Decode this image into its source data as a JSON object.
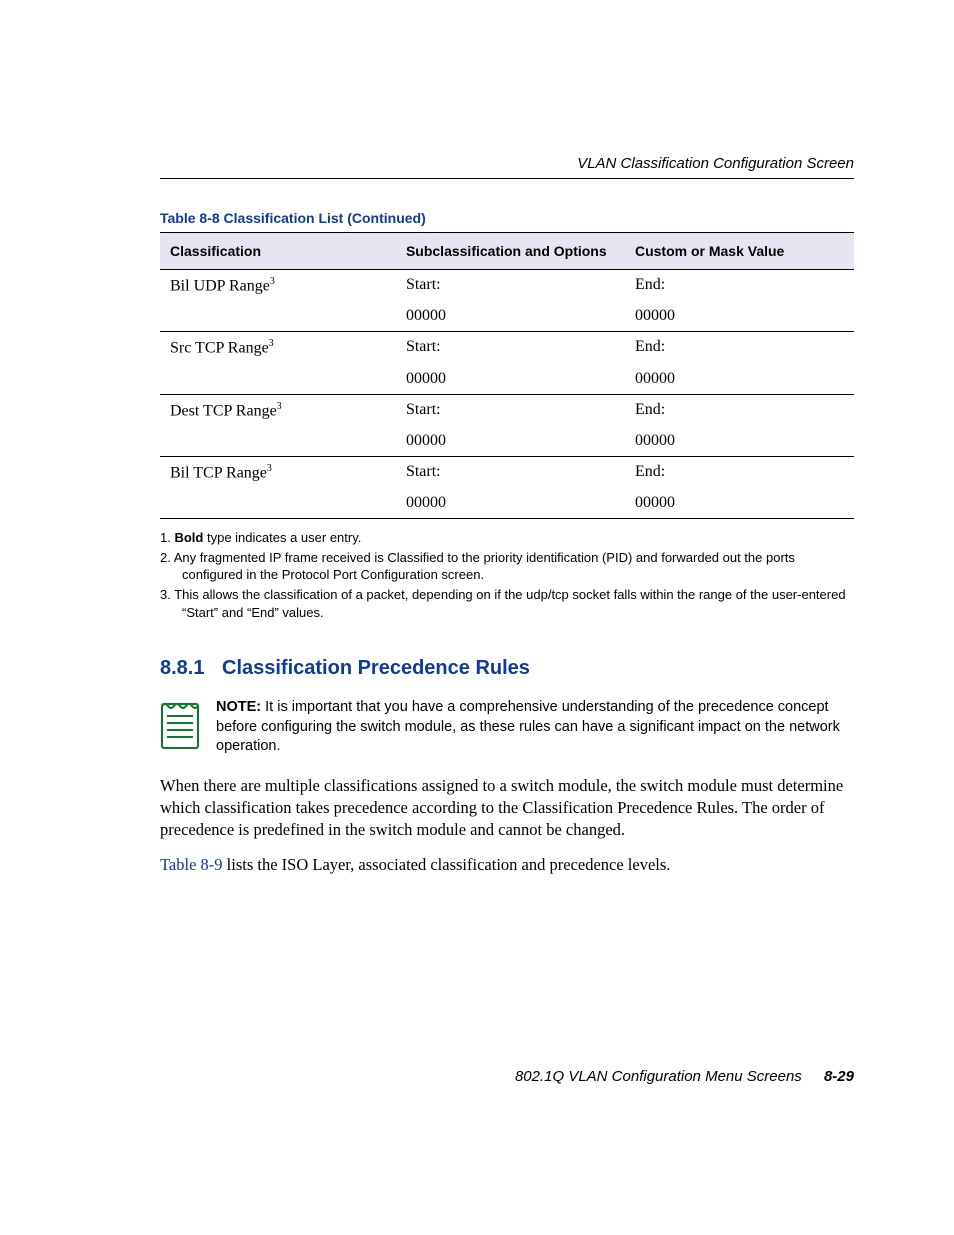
{
  "header": {
    "running_head": "VLAN Classification Configuration Screen"
  },
  "table": {
    "caption": "Table 8-8   Classification List (Continued)",
    "columns": {
      "c1": "Classification",
      "c2": "Subclassification and Options",
      "c3": "Custom or Mask Value"
    },
    "rows": [
      {
        "name": "Bil UDP Range",
        "sup": "3",
        "start_label": "Start:",
        "end_label": "End:",
        "start_val": "00000",
        "end_val": "00000"
      },
      {
        "name": "Src TCP Range",
        "sup": "3",
        "start_label": "Start:",
        "end_label": "End:",
        "start_val": "00000",
        "end_val": "00000"
      },
      {
        "name": "Dest TCP Range",
        "sup": "3",
        "start_label": "Start:",
        "end_label": "End:",
        "start_val": "00000",
        "end_val": "00000"
      },
      {
        "name": "Bil TCP Range",
        "sup": "3",
        "start_label": "Start:",
        "end_label": "End:",
        "start_val": "00000",
        "end_val": "00000"
      }
    ]
  },
  "footnotes": {
    "f1_pre": "1. ",
    "f1_bold": "Bold",
    "f1_post": " type indicates a user entry.",
    "f2": "2. Any fragmented IP frame received is Classified to the priority identification (PID) and forwarded out the ports configured in the Protocol Port Configuration screen.",
    "f3": "3. This allows the classification of a packet, depending on if the udp/tcp socket falls within the range of the user-entered “Start” and “End” values."
  },
  "section": {
    "number": "8.8.1",
    "title": "Classification Precedence Rules"
  },
  "note": {
    "label": "NOTE:",
    "text": "  It is important that you have a comprehensive understanding of the precedence concept before configuring the switch module, as these rules can have a significant impact on the network operation."
  },
  "body": {
    "p1": "When there are multiple classifications assigned to a switch module, the switch module must determine which classification takes precedence according to the Classification Precedence Rules. The order of precedence is predefined in the switch module and cannot be changed.",
    "p2_link": "Table 8-9",
    "p2_rest": " lists the ISO Layer, associated classification and precedence levels."
  },
  "footer": {
    "text": "802.1Q VLAN Configuration Menu Screens",
    "page": "8-29"
  }
}
